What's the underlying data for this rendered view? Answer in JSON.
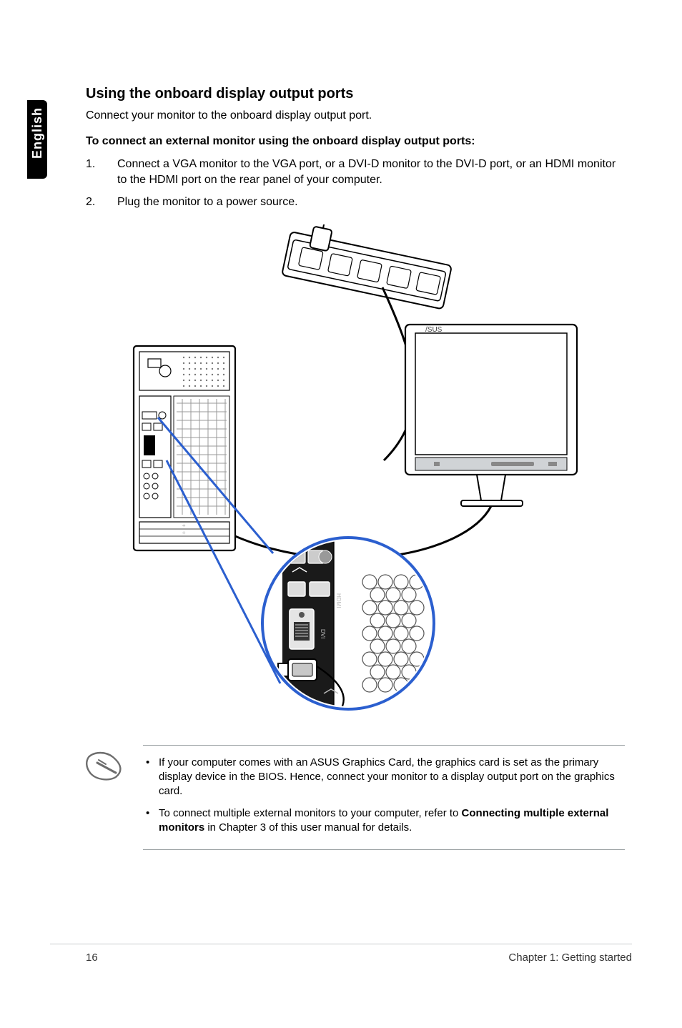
{
  "sideTab": "English",
  "section": {
    "title": "Using the onboard display output ports",
    "lead": "Connect your monitor to the onboard display output port.",
    "subhead": "To connect an external monitor using the onboard display output ports:",
    "steps": [
      {
        "num": "1.",
        "text": "Connect a VGA monitor to the VGA port, or a DVI-D monitor to the DVI-D port, or an HDMI monitor to the HDMI port on the rear panel of your computer."
      },
      {
        "num": "2.",
        "text": "Plug the monitor to a power source."
      }
    ]
  },
  "notes": [
    {
      "pre": "If your computer comes with an ASUS Graphics Card, the graphics card is set as the primary display device in the BIOS. Hence, connect your monitor to a display output port on the graphics card."
    },
    {
      "pre": "To connect multiple external monitors to your computer, refer to ",
      "bold": "Connecting multiple external monitors",
      "post": " in Chapter 3 of this user manual for details."
    }
  ],
  "footer": {
    "pageNum": "16",
    "chapter": "Chapter 1: Getting started"
  },
  "figure": {
    "monitorBrand": "/SUS",
    "labels": {
      "hdmi": "HDMI",
      "dvi": "DVI"
    }
  }
}
